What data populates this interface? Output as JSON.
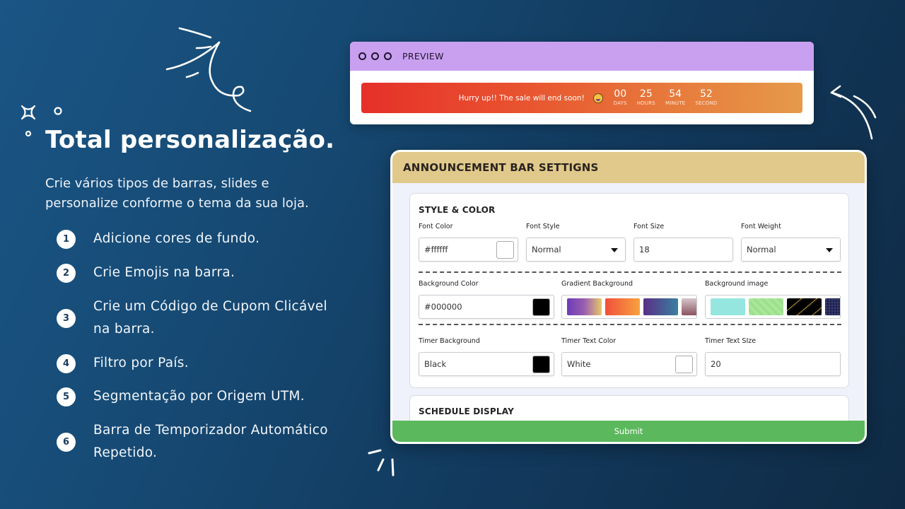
{
  "headline": "Total personalização.",
  "subtext": "Crie vários tipos de barras, slides e personalize conforme o tema da sua loja.",
  "features": [
    {
      "num": "1",
      "text": "Adicione cores de fundo."
    },
    {
      "num": "2",
      "text": "Crie Emojis na barra."
    },
    {
      "num": "3",
      "text": "Crie um Código de Cupom Clicável na barra."
    },
    {
      "num": "4",
      "text": "Filtro por País."
    },
    {
      "num": "5",
      "text": "Segmentação por Origem UTM."
    },
    {
      "num": "6",
      "text": "Barra de Temporizador Automático Repetido."
    }
  ],
  "preview": {
    "title": "PREVIEW",
    "message": "Hurry up!! The sale will end soon!",
    "emoji": "laughing-face-emoji",
    "timer": [
      {
        "value": "00",
        "label": "DAYS"
      },
      {
        "value": "25",
        "label": "HOURS"
      },
      {
        "value": "54",
        "label": "MINUTE"
      },
      {
        "value": "52",
        "label": "SECOND"
      }
    ]
  },
  "settings": {
    "title": "ANNOUNCEMENT BAR SETTIGNS",
    "style_section": {
      "title": "STYLE & COLOR",
      "font_color": {
        "label": "Font Color",
        "value": "#ffffff",
        "swatch": "#ffffff"
      },
      "font_style": {
        "label": "Font Style",
        "value": "Normal"
      },
      "font_size": {
        "label": "Font Size",
        "value": "18"
      },
      "font_weight": {
        "label": "Font Weight",
        "value": "Normal"
      },
      "background_color": {
        "label": "Background Color",
        "value": "#000000",
        "swatch": "#000000"
      },
      "gradient_background": {
        "label": "Gradient Background"
      },
      "background_image": {
        "label": "Background image"
      },
      "timer_background": {
        "label": "Timer Background",
        "value": "Black",
        "swatch": "#000000"
      },
      "timer_text_color": {
        "label": "Timer Text Color",
        "value": "White",
        "swatch": "#ffffff"
      },
      "timer_text_size": {
        "label": "Timer Text SIze",
        "value": "20"
      }
    },
    "schedule_section": {
      "title": "SCHEDULE DISPLAY"
    },
    "submit_label": "Submit"
  },
  "colors": {
    "preview_header": "#c9a0ef",
    "settings_header": "#e0c98a",
    "submit": "#5cb85c"
  }
}
